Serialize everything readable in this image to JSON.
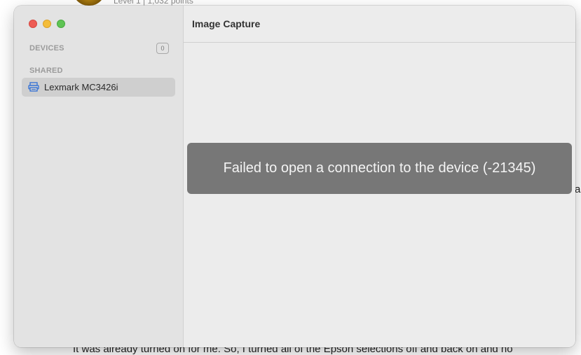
{
  "background": {
    "top_text": "Level 1 | 1,032 points",
    "side_text": "a",
    "bottom_text": "It was already turned on for me.  So, I turned all of the Epson selections off and back on and no"
  },
  "window": {
    "title": "Image Capture",
    "sidebar": {
      "devices_label": "DEVICES",
      "devices_count": "0",
      "shared_label": "SHARED",
      "items": [
        {
          "label": "Lexmark MC3426i",
          "icon": "printer-icon"
        }
      ]
    },
    "error_message": "Failed to open a connection to the device (-21345)"
  },
  "colors": {
    "accent": "#2f6fd6",
    "error_banner": "#777777",
    "close": "#ee5c54",
    "minimize": "#f4bd3a",
    "maximize": "#5fc454"
  }
}
